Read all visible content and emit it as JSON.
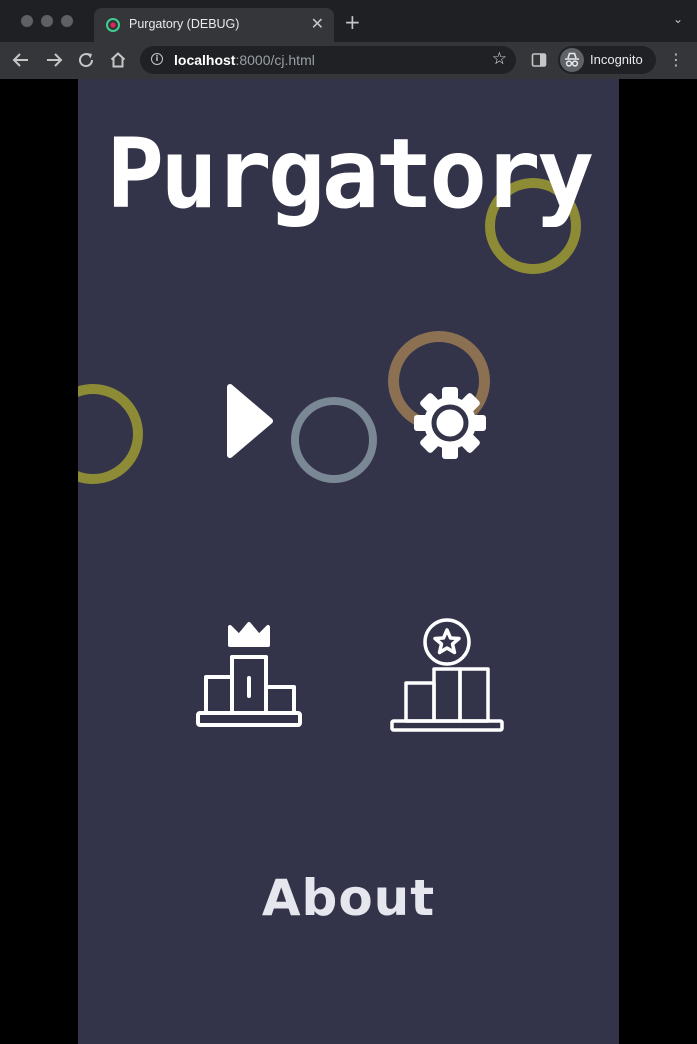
{
  "browser": {
    "tab_title": "Purgatory (DEBUG)",
    "url_host": "localhost",
    "url_path": ":8000/cj.html",
    "profile_label": "Incognito"
  },
  "game": {
    "title": "Purgatory",
    "about_label": "About",
    "background_color": "#33334a",
    "ring_colors": [
      "#8d8b35",
      "#7a8795",
      "#8c7052"
    ],
    "icons": [
      "play-icon",
      "settings-gear-icon",
      "leaderboard-podium-crown-icon",
      "achievements-podium-star-icon"
    ]
  }
}
